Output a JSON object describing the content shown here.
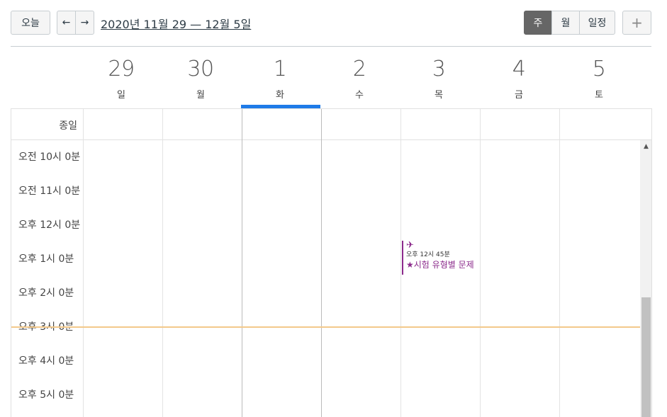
{
  "toolbar": {
    "today_label": "오늘",
    "prev_icon": "←",
    "next_icon": "→",
    "range_title": "2020년 11월 29 — 12월 5일",
    "views": {
      "week": "주",
      "month": "월",
      "agenda": "일정"
    },
    "add_icon": "+"
  },
  "days": [
    {
      "num": "29",
      "name": "일"
    },
    {
      "num": "30",
      "name": "월"
    },
    {
      "num": "1",
      "name": "화"
    },
    {
      "num": "2",
      "name": "수"
    },
    {
      "num": "3",
      "name": "목"
    },
    {
      "num": "4",
      "name": "금"
    },
    {
      "num": "5",
      "name": "토"
    }
  ],
  "allday_label": "종일",
  "time_labels": [
    "오전 10시 0분",
    "오전 11시 0분",
    "오후 12시 0분",
    "오후 1시 0분",
    "오후 2시 0분",
    "오후 3시 0분",
    "오후 4시 0분",
    "오후 5시 0분"
  ],
  "event": {
    "icon": "✈",
    "time": "오후 12시 45분",
    "title": "★시험 유형별 문제"
  },
  "colors": {
    "accent": "#1e7be8",
    "event": "#8b2a8b",
    "now_line": "#f3c98b",
    "active_view": "#666666"
  }
}
